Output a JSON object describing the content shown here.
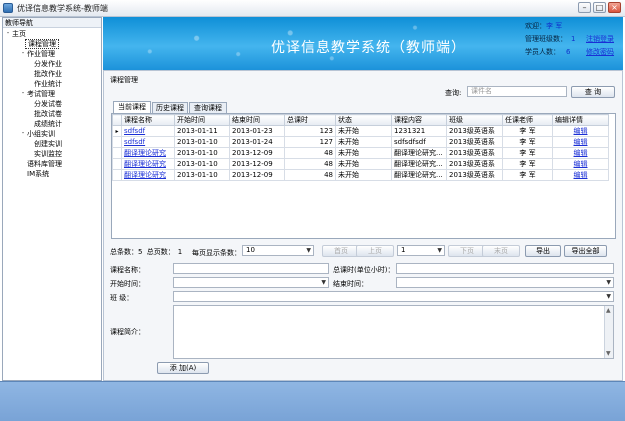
{
  "window": {
    "title": "优译信息教学系统-教师端"
  },
  "nav": {
    "header": "教师导航",
    "items": [
      {
        "label": "主页",
        "level": 0,
        "toggle": "-"
      },
      {
        "label": "课程管理",
        "level": 1,
        "selected": true
      },
      {
        "label": "作业管理",
        "level": 1,
        "toggle": "-"
      },
      {
        "label": "分发作业",
        "level": 2
      },
      {
        "label": "批改作业",
        "level": 2
      },
      {
        "label": "作业统计",
        "level": 2
      },
      {
        "label": "考试管理",
        "level": 1,
        "toggle": "-"
      },
      {
        "label": "分发试卷",
        "level": 2
      },
      {
        "label": "批改试卷",
        "level": 2
      },
      {
        "label": "成绩统计",
        "level": 2
      },
      {
        "label": "小组实训",
        "level": 1,
        "toggle": "-"
      },
      {
        "label": "创建实训",
        "level": 2
      },
      {
        "label": "实训监控",
        "level": 2
      },
      {
        "label": "语料库管理",
        "level": 1
      },
      {
        "label": "IM系统",
        "level": 1
      }
    ]
  },
  "banner": {
    "heading": "优译信息教学系统（教师端）",
    "welcome_label": "欢迎：",
    "welcome_value": "李 军",
    "classes_label": "管理班级数：",
    "classes_value": "1",
    "students_label": "学员人数：",
    "students_value": "6",
    "logout_link": "注销登录",
    "password_link": "修改密码"
  },
  "main": {
    "section_title": "课程管理",
    "search_label": "查询:",
    "search_placeholder": "课件名",
    "search_button": "查 询",
    "tabs": [
      "当前课程",
      "历史课程",
      "查询课程"
    ],
    "table": {
      "columns": [
        "课程名称",
        "开始时间",
        "结束时间",
        "总课时",
        "状态",
        "课程内容",
        "班级",
        "任课老师",
        "编辑详情"
      ],
      "rows": [
        {
          "name": "sdfsdf",
          "start": "2013-01-11",
          "end": "2013-01-23",
          "hours": "123",
          "status": "未开始",
          "content": "1231321",
          "class": "2013级英语系",
          "teacher": "李 军",
          "action": "编辑",
          "current": true
        },
        {
          "name": "sdfsdf",
          "start": "2013-01-10",
          "end": "2013-01-24",
          "hours": "127",
          "status": "未开始",
          "content": "sdfsdfsdf",
          "class": "2013级英语系",
          "teacher": "李 军",
          "action": "编辑"
        },
        {
          "name": "翻译理论研究",
          "start": "2013-01-10",
          "end": "2013-12-09",
          "hours": "48",
          "status": "未开始",
          "content": "翻译理论研究...",
          "class": "2013级英语系",
          "teacher": "李 军",
          "action": "编辑"
        },
        {
          "name": "翻译理论研究",
          "start": "2013-01-10",
          "end": "2013-12-09",
          "hours": "48",
          "status": "未开始",
          "content": "翻译理论研究...",
          "class": "2013级英语系",
          "teacher": "李 军",
          "action": "编辑"
        },
        {
          "name": "翻译理论研究",
          "start": "2013-01-10",
          "end": "2013-12-09",
          "hours": "48",
          "status": "未开始",
          "content": "翻译理论研究...",
          "class": "2013级英语系",
          "teacher": "李 军",
          "action": "编辑"
        }
      ]
    },
    "pager": {
      "total_label": "总条数：",
      "total_value": "5",
      "pages_label": "总页数：",
      "pages_value": "1",
      "per_page_label": "每页显示条数：",
      "per_page_value": "10",
      "first": "首页",
      "prev": "上页",
      "page_value": "1",
      "next": "下页",
      "last": "末页",
      "export": "导出",
      "export_all": "导出全部"
    },
    "form": {
      "course_name_label": "课程名称：",
      "total_hours_label": "总课时(单位小时)：",
      "start_time_label": "开始时间：",
      "end_time_label": "结束时间：",
      "class_label": "班   级：",
      "intro_label": "课程简介：",
      "add_button": "添 加(A)"
    }
  }
}
